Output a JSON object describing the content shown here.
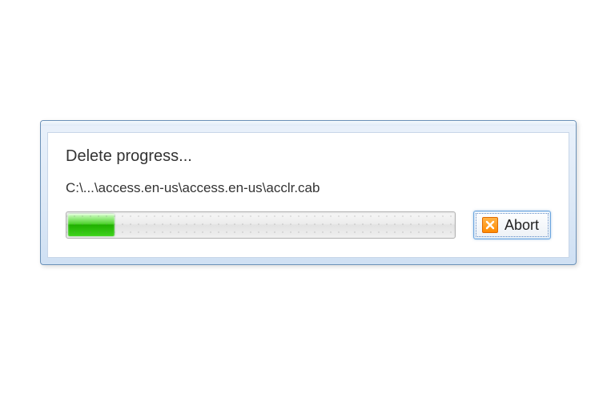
{
  "dialog": {
    "title": "Delete progress...",
    "path": "C:\\...\\access.en-us\\access.en-us\\acclr.cab",
    "progress_percent": 12,
    "abort_label": "Abort"
  },
  "colors": {
    "window_border": "#6b91b8",
    "progress_fill": "#20b000",
    "button_border": "#6fa7df",
    "abort_icon_bg": "#ff8a00"
  }
}
